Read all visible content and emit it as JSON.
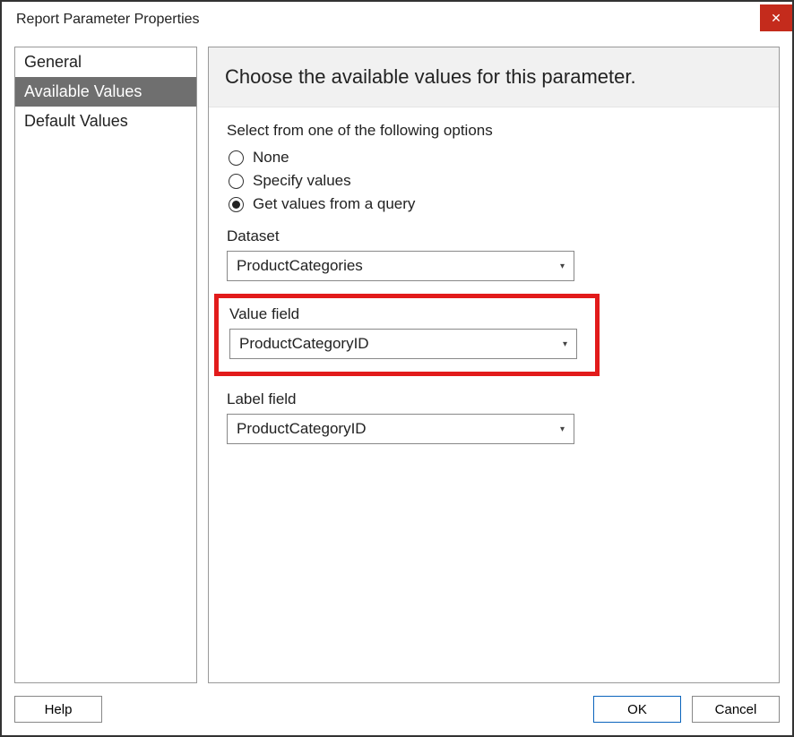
{
  "title": "Report Parameter Properties",
  "sidebar": {
    "items": [
      {
        "label": "General"
      },
      {
        "label": "Available Values"
      },
      {
        "label": "Default Values"
      }
    ],
    "selected_index": 1
  },
  "main": {
    "header": "Choose the available values for this parameter.",
    "options_label": "Select from one of the following options",
    "radios": [
      {
        "label": "None"
      },
      {
        "label": "Specify values"
      },
      {
        "label": "Get values from a query"
      }
    ],
    "selected_radio": 2,
    "dataset": {
      "label": "Dataset",
      "value": "ProductCategories"
    },
    "value_field": {
      "label": "Value field",
      "value": "ProductCategoryID"
    },
    "label_field": {
      "label": "Label field",
      "value": "ProductCategoryID"
    }
  },
  "footer": {
    "help": "Help",
    "ok": "OK",
    "cancel": "Cancel"
  }
}
